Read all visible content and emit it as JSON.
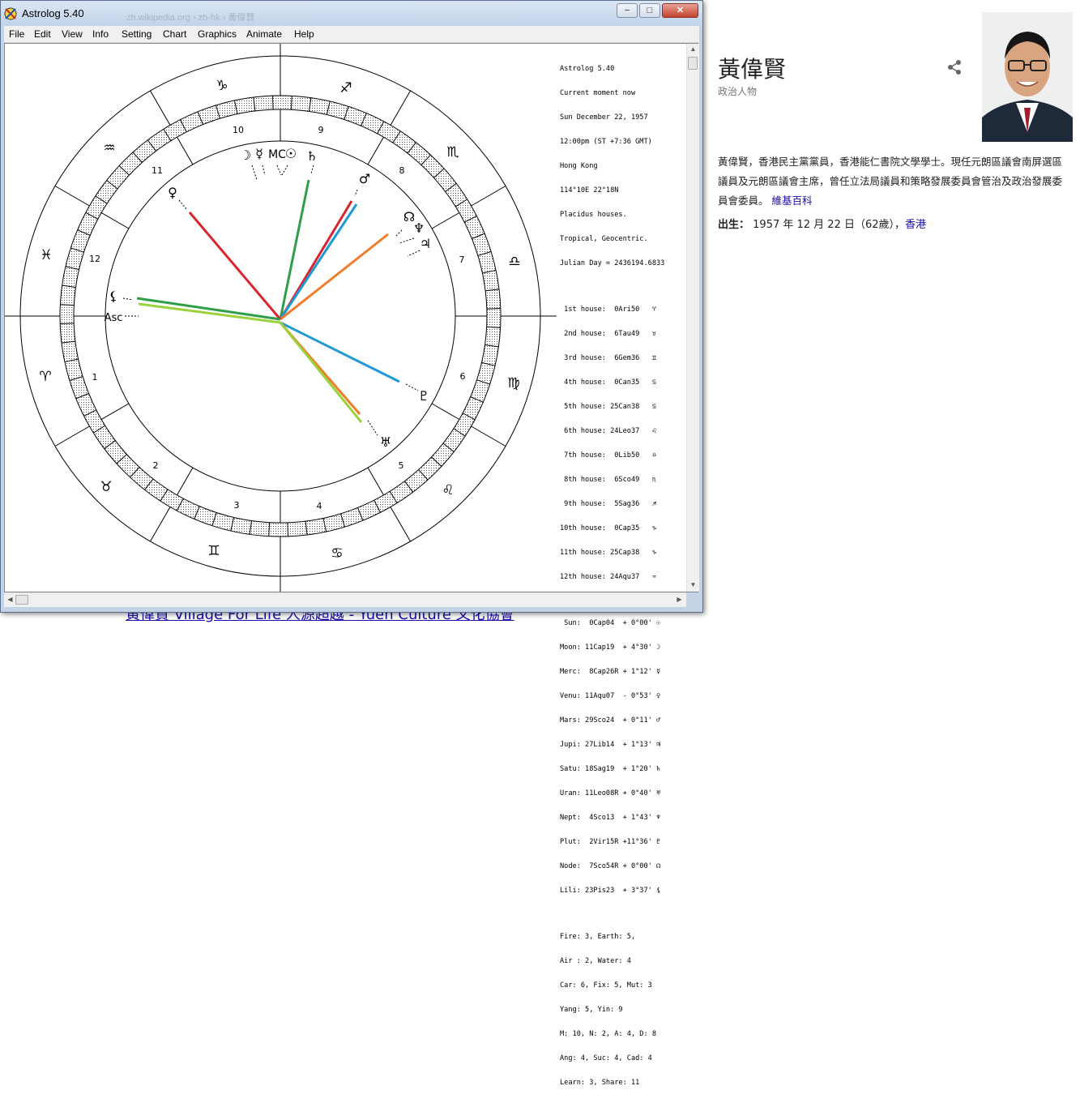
{
  "background": {
    "link_text": "黃偉賢 Village For Life 人源超越 - Yuen Culture 文化協會",
    "url_ghost": "zh.wikipedia.org › zh-hk › 黃偉賢"
  },
  "knowledge_panel": {
    "name": "黃偉賢",
    "subtitle": "政治人物",
    "description": "黃偉賢，香港民主黨黨員，香港能仁書院文學學士。現任元朗區議會南屏選區議員及元朗區議會主席，曾任立法局議員和策略發展委員會管治及政治發展委員會委員。",
    "source_link": "維基百科",
    "born_label": "出生：",
    "born_value": "1957 年 12 月 22 日（62歲），",
    "born_place": "香港"
  },
  "window": {
    "title": "Astrolog 5.40",
    "buttons": {
      "minimize": "−",
      "maximize": "□",
      "close": "✕"
    },
    "menu": [
      "File",
      "Edit",
      "View",
      "Info",
      "Setting",
      "Chart",
      "Graphics",
      "Animate",
      "Help"
    ]
  },
  "info_panel": {
    "header": [
      "Astrolog 5.40",
      "Current moment now",
      "Sun December 22, 1957",
      "12:00pm (ST +7:36 GMT)",
      "Hong Kong",
      "114°10E 22°18N",
      "Placidus houses.",
      "Tropical, Geocentric.",
      "Julian Day = 2436194.6833"
    ],
    "houses": [
      " 1st house:  0Ari50   ♈",
      " 2nd house:  6Tau49   ♉",
      " 3rd house:  6Gem36   ♊",
      " 4th house:  0Can35   ♋",
      " 5th house: 25Can38   ♋",
      " 6th house: 24Leo37   ♌",
      " 7th house:  0Lib50   ♎",
      " 8th house:  6Sco49   ♏",
      " 9th house:  5Sag36   ♐",
      "10th house:  0Cap35   ♑",
      "11th house: 25Cap38   ♑",
      "12th house: 24Aqu37   ♒"
    ],
    "planets": [
      " Sun:  0Cap04  + 0°00' ☉",
      "Moon: 11Cap19  + 4°30' ☽",
      "Merc:  8Cap26R + 1°12' ☿",
      "Venu: 11Aqu07  - 0°53' ♀",
      "Mars: 29Sco24  + 0°11' ♂",
      "Jupi: 27Lib14  + 1°13' ♃",
      "Satu: 18Sag19  + 1°20' ♄",
      "Uran: 11Leo08R + 0°40' ♅",
      "Nept:  4Sco13  + 1°43' ♆",
      "Plut:  2Vir15R +11°36' ♇",
      "Node:  7Sco54R + 0°00' ☊",
      "Lili: 23Pis23  + 3°37' ⚸"
    ],
    "stats": [
      "Fire: 3, Earth: 5,",
      "Air : 2, Water: 4",
      "Car: 6, Fix: 5, Mut: 3",
      "Yang: 5, Yin: 9",
      "M: 10, N: 2, A: 4, D: 8",
      "Ang: 4, Suc: 4, Cad: 4",
      "Learn: 3, Share: 11"
    ]
  },
  "chart": {
    "zodiac_glyphs": [
      "♑",
      "♐",
      "♏",
      "♎",
      "♍",
      "♌",
      "♋",
      "♊",
      "♉",
      "♈",
      "♓",
      "♒"
    ],
    "house_numbers": [
      "10",
      "9",
      "8",
      "7",
      "6",
      "5",
      "4",
      "3",
      "2",
      "1",
      "12",
      "11"
    ],
    "planet_glyphs": {
      "moon": "☽",
      "mercury": "☿",
      "midheaven": "MC",
      "sun": "☉",
      "saturn": "♄",
      "mars": "♂",
      "node": "☊",
      "neptune": "♆",
      "jupiter": "♃",
      "venus": "♀",
      "lilith": "⚸",
      "ascendant": "Asc",
      "pluto": "♇",
      "uranus": "♅"
    },
    "aspect_colors": {
      "green": "#2e9e48",
      "red": "#d8262e",
      "blue": "#1e9ad6",
      "orange": "#f07c2a",
      "lime": "#9bd23c"
    }
  }
}
